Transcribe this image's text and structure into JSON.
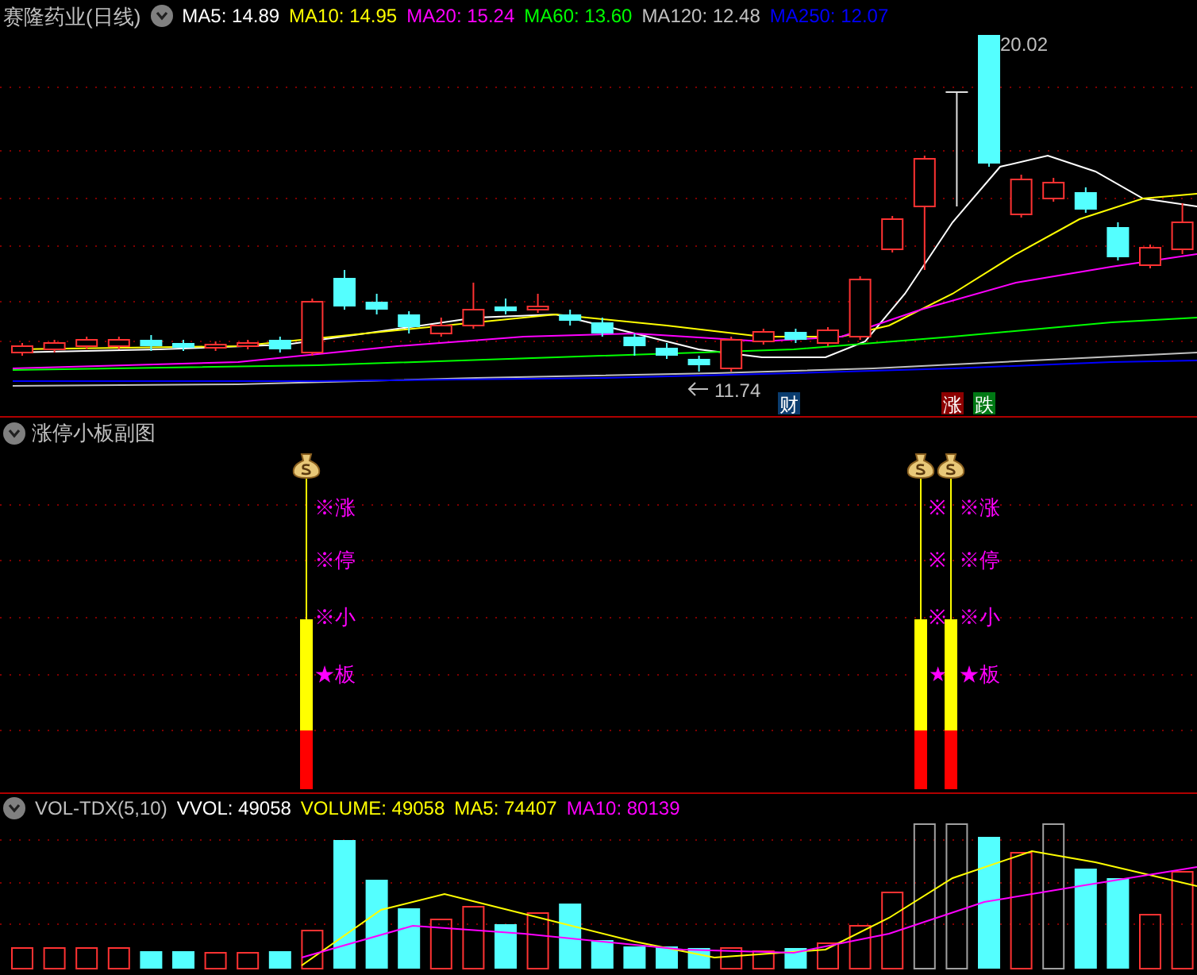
{
  "price_panel": {
    "title": "赛隆药业(日线)",
    "indicators": [
      {
        "label": "MA5: 14.89",
        "color": "#ffffff"
      },
      {
        "label": "MA10: 14.95",
        "color": "#ffff00"
      },
      {
        "label": "MA20: 15.24",
        "color": "#ff00ff"
      },
      {
        "label": "MA60: 13.60",
        "color": "#00ff00"
      },
      {
        "label": "MA120: 12.48",
        "color": "#c0c0c0"
      },
      {
        "label": "MA250: 12.07",
        "color": "#0000ff"
      }
    ],
    "high_label": "20.02",
    "low_label": "11.74",
    "events": [
      {
        "label": "财",
        "color": "#0a3c6e"
      },
      {
        "label": "涨",
        "color": "#8c0000"
      },
      {
        "label": "跌",
        "color": "#007814"
      }
    ]
  },
  "signal_panel": {
    "title": "涨停小板副图",
    "signals": [
      {
        "labels": [
          "※涨",
          "※停",
          "※小",
          "★板"
        ]
      },
      {
        "labels": [
          "※",
          "※",
          "※",
          "★"
        ]
      },
      {
        "labels": [
          "※涨",
          "※停",
          "※小",
          "★板"
        ]
      }
    ]
  },
  "volume_panel": {
    "title": "VOL-TDX(5,10)",
    "indicators": [
      {
        "label": "VVOL: 49058",
        "color": "#ffffff"
      },
      {
        "label": "VOLUME: 49058",
        "color": "#ffff00"
      },
      {
        "label": "MA5: 74407",
        "color": "#ffff00"
      },
      {
        "label": "MA10: 80139",
        "color": "#ff00ff"
      }
    ]
  }
}
